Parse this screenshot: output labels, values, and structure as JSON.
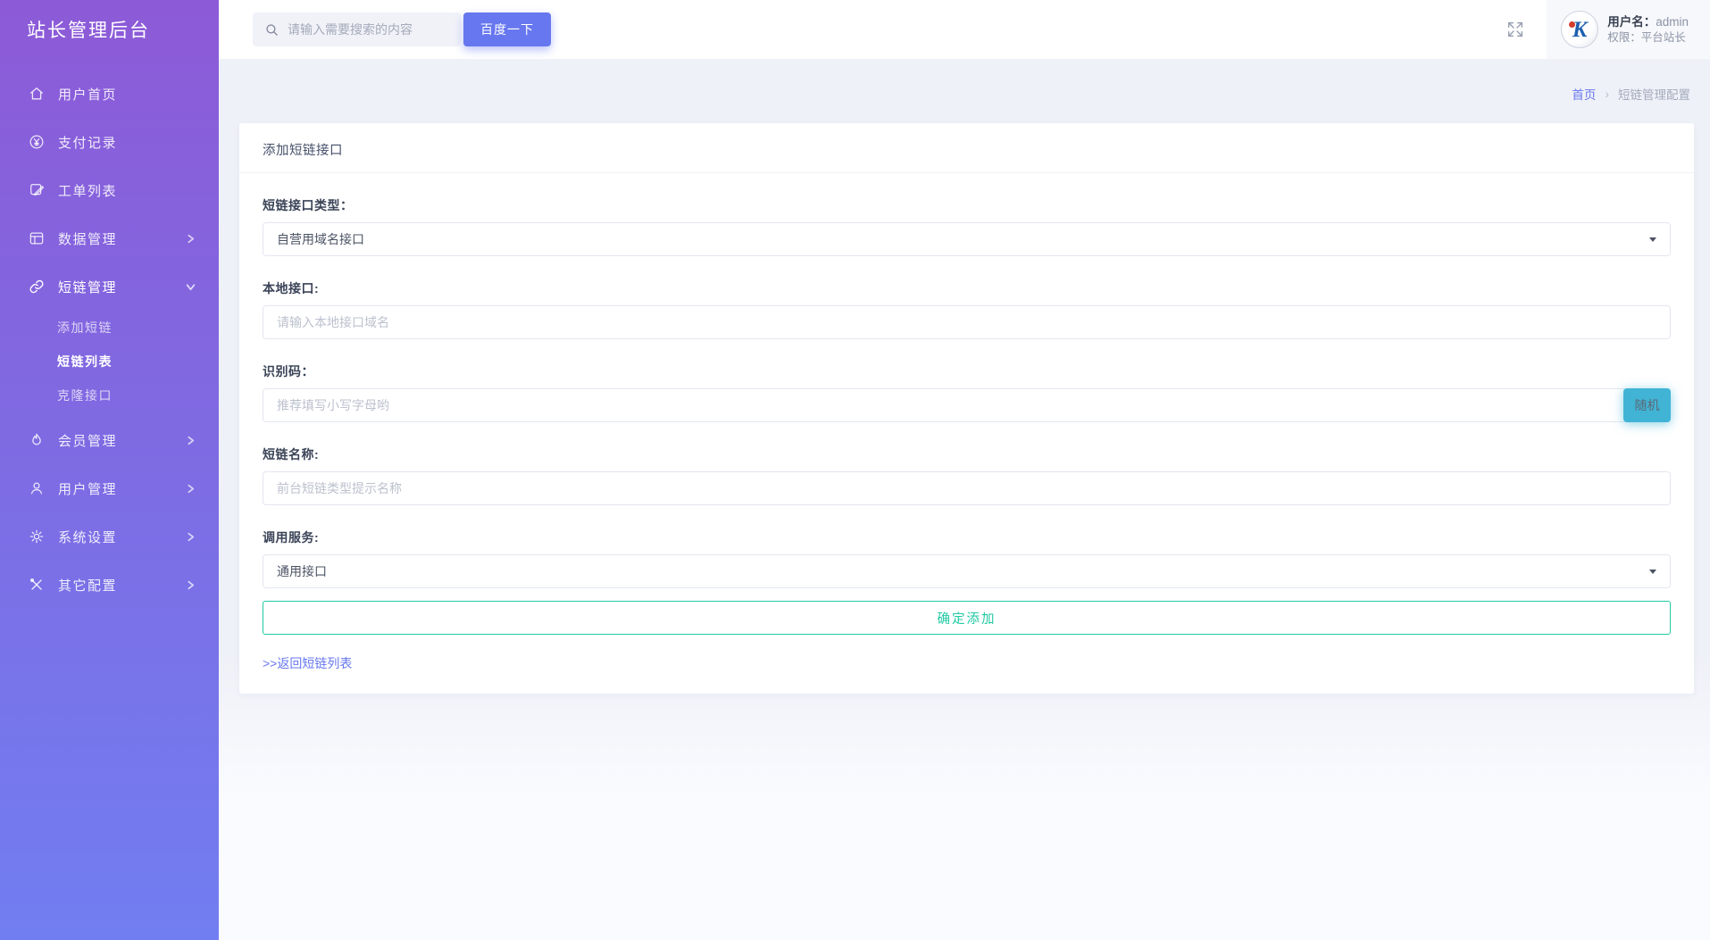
{
  "colors": {
    "accent": "#6777ef",
    "info_button": "#41b4d6",
    "success": "#21c9a3",
    "sidebar_gradient_top": "#8d5ad7",
    "sidebar_gradient_bottom": "#717ef1"
  },
  "sidebar": {
    "title": "站长管理后台",
    "items": [
      {
        "label": "用户首页",
        "icon": "home-icon"
      },
      {
        "label": "支付记录",
        "icon": "yen-circle-icon"
      },
      {
        "label": "工单列表",
        "icon": "ticket-icon"
      },
      {
        "label": "数据管理",
        "icon": "data-table-icon",
        "chevron": "right"
      },
      {
        "label": "短链管理",
        "icon": "chain-link-icon",
        "chevron": "down",
        "expanded": true
      },
      {
        "label": "会员管理",
        "icon": "flame-icon",
        "chevron": "right"
      },
      {
        "label": "用户管理",
        "icon": "user-icon",
        "chevron": "right"
      },
      {
        "label": "系统设置",
        "icon": "gear-icon",
        "chevron": "right"
      },
      {
        "label": "其它配置",
        "icon": "tools-icon",
        "chevron": "right"
      }
    ],
    "shortlink_submenu": [
      {
        "label": "添加短链",
        "active": false
      },
      {
        "label": "短链列表",
        "active": true
      },
      {
        "label": "克隆接口",
        "active": false
      }
    ]
  },
  "topbar": {
    "search_placeholder": "请输入需要搜索的内容",
    "search_button": "百度一下",
    "fullscreen_icon": "expand-icon",
    "user": {
      "name_label": "用户名：",
      "name": "admin",
      "role_label": "权限：",
      "role": "平台站长"
    }
  },
  "breadcrumb": {
    "home": "首页",
    "separator": "›",
    "current": "短链管理配置"
  },
  "form": {
    "card_title": "添加短链接口",
    "type_label": "短链接口类型：",
    "type_value": "自营用域名接口",
    "local_label": "本地接口:",
    "local_placeholder": "请输入本地接口域名",
    "code_label": "识别码：",
    "code_placeholder": "推荐填写小写字母哟",
    "random_button": "随机",
    "name_label": "短链名称:",
    "name_placeholder": "前台短链类型提示名称",
    "service_label": "调用服务:",
    "service_value": "通用接口",
    "submit_button": "确定添加",
    "back_link": ">>返回短链列表"
  }
}
